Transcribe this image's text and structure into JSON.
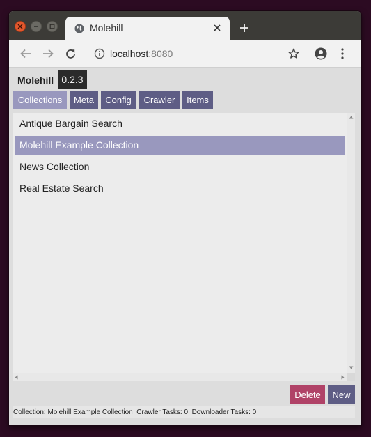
{
  "browser": {
    "tab_title": "Molehill",
    "url_host": "localhost",
    "url_port": ":8080"
  },
  "app": {
    "name": "Molehill",
    "version": "0.2.3"
  },
  "nav": {
    "tabs": [
      {
        "label": "Collections",
        "active": true
      },
      {
        "label": "Meta",
        "active": false
      },
      {
        "label": "Config",
        "active": false
      },
      {
        "label": "Crawler",
        "active": false
      },
      {
        "label": "Items",
        "active": false
      }
    ]
  },
  "collections": {
    "items": [
      {
        "label": "Antique Bargain Search",
        "selected": false
      },
      {
        "label": "Molehill Example Collection",
        "selected": true
      },
      {
        "label": "News Collection",
        "selected": false
      },
      {
        "label": "Real Estate Search",
        "selected": false
      }
    ]
  },
  "actions": {
    "delete_label": "Delete",
    "new_label": "New"
  },
  "status": {
    "text": "Collection: Molehill Example Collection  Crawler Tasks: 0  Downloader Tasks: 0"
  },
  "colors": {
    "accent": "#5e5d85",
    "selected": "#9998be",
    "danger": "#b04267"
  }
}
